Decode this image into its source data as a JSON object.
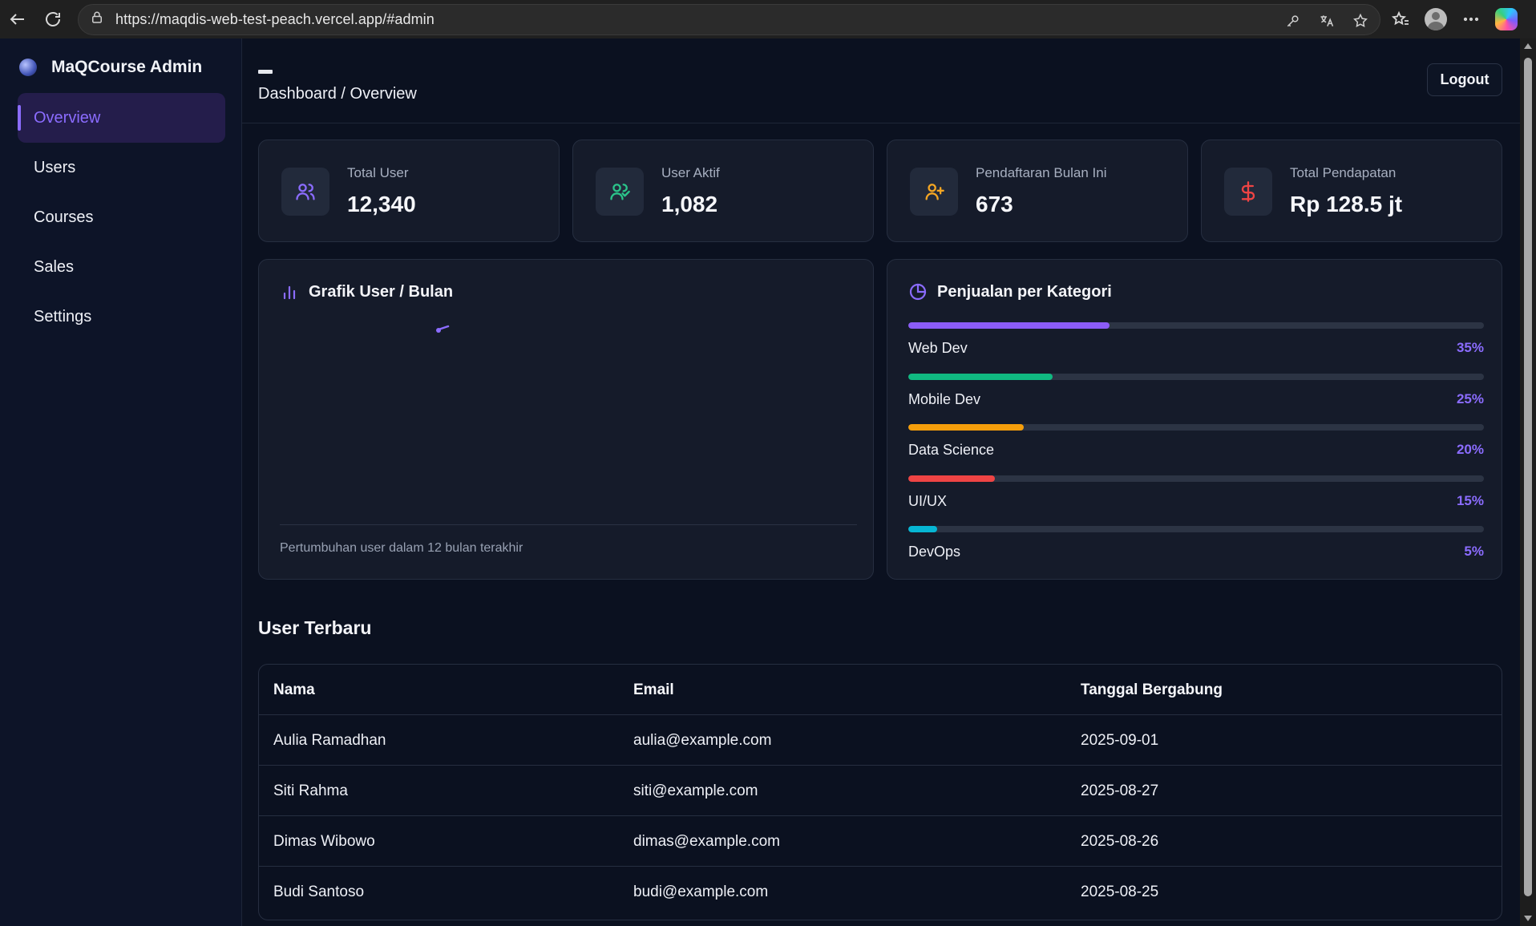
{
  "browser": {
    "url": "https://maqdis-web-test-peach.vercel.app/#admin"
  },
  "sidebar": {
    "brand": "MaQCourse Admin",
    "items": [
      {
        "label": "Overview",
        "active": true
      },
      {
        "label": "Users",
        "active": false
      },
      {
        "label": "Courses",
        "active": false
      },
      {
        "label": "Sales",
        "active": false
      },
      {
        "label": "Settings",
        "active": false
      }
    ]
  },
  "header": {
    "breadcrumb": "Dashboard / Overview",
    "logout_label": "Logout"
  },
  "stats": [
    {
      "label": "Total User",
      "value": "12,340",
      "icon": "users-icon",
      "color": "#8b6cff"
    },
    {
      "label": "User Aktif",
      "value": "1,082",
      "icon": "user-check-icon",
      "color": "#2bc48a"
    },
    {
      "label": "Pendaftaran Bulan Ini",
      "value": "673",
      "icon": "user-plus-icon",
      "color": "#f5a623"
    },
    {
      "label": "Total Pendapatan",
      "value": "Rp 128.5 jt",
      "icon": "dollar-icon",
      "color": "#ef4444"
    }
  ],
  "user_chart": {
    "title": "Grafik User / Bulan",
    "caption": "Pertumbuhan user dalam 12 bulan terakhir"
  },
  "sales_category": {
    "title": "Penjualan per Kategori",
    "items": [
      {
        "name": "Web Dev",
        "pct_label": "35%",
        "value": 35,
        "color": "#8b5cf6"
      },
      {
        "name": "Mobile Dev",
        "pct_label": "25%",
        "value": 25,
        "color": "#10b981"
      },
      {
        "name": "Data Science",
        "pct_label": "20%",
        "value": 20,
        "color": "#f59e0b"
      },
      {
        "name": "UI/UX",
        "pct_label": "15%",
        "value": 15,
        "color": "#ef4444"
      },
      {
        "name": "DevOps",
        "pct_label": "5%",
        "value": 5,
        "color": "#06b6d4"
      }
    ]
  },
  "recent_users": {
    "title": "User Terbaru",
    "columns": [
      "Nama",
      "Email",
      "Tanggal Bergabung"
    ],
    "rows": [
      [
        "Aulia Ramadhan",
        "aulia@example.com",
        "2025-09-01"
      ],
      [
        "Siti Rahma",
        "siti@example.com",
        "2025-08-27"
      ],
      [
        "Dimas Wibowo",
        "dimas@example.com",
        "2025-08-26"
      ],
      [
        "Budi Santoso",
        "budi@example.com",
        "2025-08-25"
      ]
    ]
  }
}
